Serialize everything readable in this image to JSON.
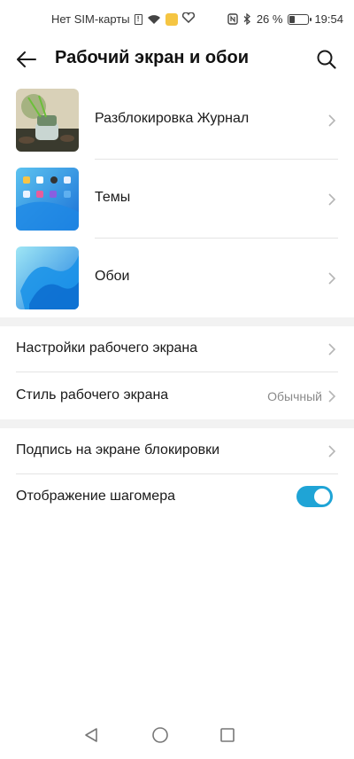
{
  "statusbar": {
    "carrier": "Нет SIM-карты",
    "battery": "26 %",
    "battery_level_percent": 26,
    "time": "19:54",
    "icons": [
      "sim-missing-icon",
      "wifi-icon",
      "notification-icon",
      "health-icon",
      "nfc-icon",
      "bluetooth-icon",
      "battery-icon"
    ]
  },
  "header": {
    "title": "Рабочий экран и обои",
    "back_icon": "back-arrow-icon",
    "search_icon": "search-icon"
  },
  "media_items": [
    {
      "label": "Разблокировка Журнал"
    },
    {
      "label": "Темы"
    },
    {
      "label": "Обои"
    }
  ],
  "home_settings": [
    {
      "label": "Настройки рабочего экрана",
      "value": ""
    },
    {
      "label": "Стиль рабочего экрана",
      "value": "Обычный"
    }
  ],
  "lock_settings": {
    "signature_label": "Подпись на экране блокировки",
    "pedometer_label": "Отображение шагомера",
    "pedometer_enabled": true
  },
  "colors": {
    "accent": "#1fa4d6",
    "divider": "#e4e4e4",
    "section_gap": "#f2f2f2"
  },
  "navbar": {
    "icons": [
      "back-triangle-icon",
      "home-circle-icon",
      "recents-square-icon"
    ]
  }
}
